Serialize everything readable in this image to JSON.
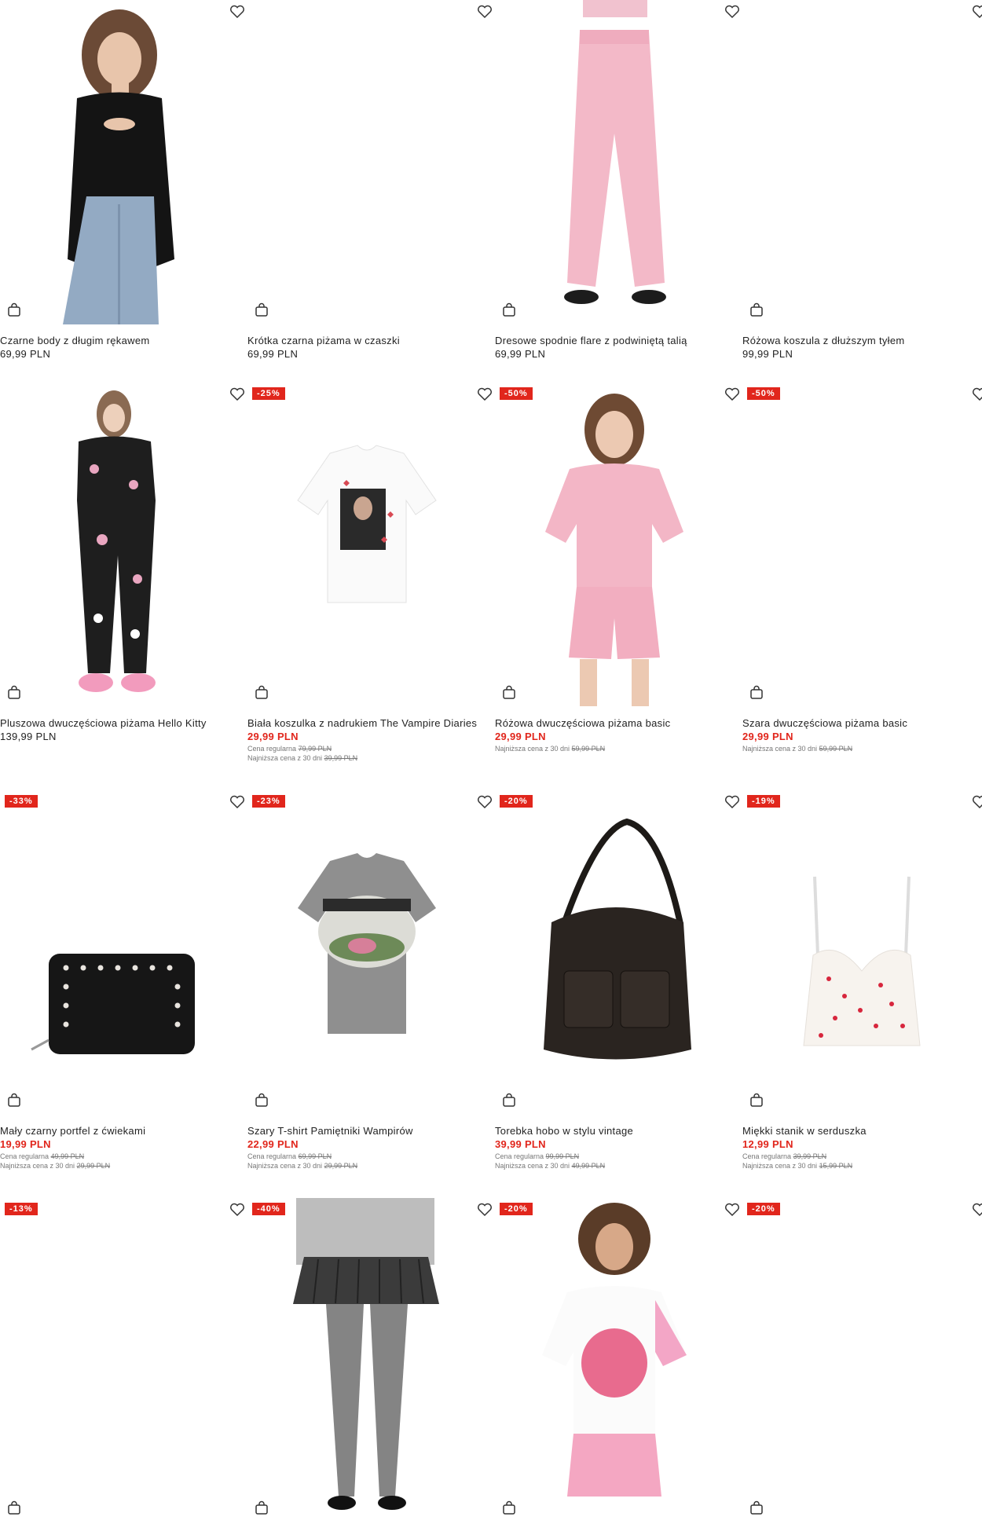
{
  "icons": {
    "wishlist": "heart-icon",
    "cart": "bag-icon"
  },
  "colors": {
    "sale": "#e1261c",
    "badge_bg": "#e1261c"
  },
  "products": [
    {
      "name": "Czarne body z długim rękawem",
      "price": "69,99 PLN",
      "badge": "",
      "regular_label": "",
      "regular": "",
      "lowest_label": "",
      "lowest": ""
    },
    {
      "name": "Krótka czarna piżama w czaszki",
      "price": "69,99 PLN",
      "badge": "",
      "regular_label": "",
      "regular": "",
      "lowest_label": "",
      "lowest": ""
    },
    {
      "name": "Dresowe spodnie flare z podwiniętą talią",
      "price": "69,99 PLN",
      "badge": "",
      "regular_label": "",
      "regular": "",
      "lowest_label": "",
      "lowest": ""
    },
    {
      "name": "Różowa koszula z dłuższym tyłem",
      "price": "99,99 PLN",
      "badge": "",
      "regular_label": "",
      "regular": "",
      "lowest_label": "",
      "lowest": ""
    },
    {
      "name": "Pluszowa dwuczęściowa piżama Hello Kitty",
      "price": "139,99 PLN",
      "badge": "",
      "regular_label": "",
      "regular": "",
      "lowest_label": "",
      "lowest": ""
    },
    {
      "name": "Biała koszulka z nadrukiem The Vampire Diaries",
      "price": "29,99 PLN",
      "badge": "-25%",
      "regular_label": "Cena regularna",
      "regular": "79,99 PLN",
      "lowest_label": "Najniższa cena z 30 dni",
      "lowest": "39,99 PLN"
    },
    {
      "name": "Różowa dwuczęściowa piżama basic",
      "price": "29,99 PLN",
      "badge": "-50%",
      "regular_label": "",
      "regular": "",
      "lowest_label": "Najniższa cena z 30 dni",
      "lowest": "59,99 PLN"
    },
    {
      "name": "Szara dwuczęściowa piżama basic",
      "price": "29,99 PLN",
      "badge": "-50%",
      "regular_label": "",
      "regular": "",
      "lowest_label": "Najniższa cena z 30 dni",
      "lowest": "59,99 PLN"
    },
    {
      "name": "Mały czarny portfel z ćwiekami",
      "price": "19,99 PLN",
      "badge": "-33%",
      "regular_label": "Cena regularna",
      "regular": "49,99 PLN",
      "lowest_label": "Najniższa cena z 30 dni",
      "lowest": "29,99 PLN"
    },
    {
      "name": "Szary T-shirt Pamiętniki Wampirów",
      "price": "22,99 PLN",
      "badge": "-23%",
      "regular_label": "Cena regularna",
      "regular": "69,99 PLN",
      "lowest_label": "Najniższa cena z 30 dni",
      "lowest": "29,99 PLN"
    },
    {
      "name": "Torebka hobo w stylu vintage",
      "price": "39,99 PLN",
      "badge": "-20%",
      "regular_label": "Cena regularna",
      "regular": "99,99 PLN",
      "lowest_label": "Najniższa cena z 30 dni",
      "lowest": "49,99 PLN"
    },
    {
      "name": "Miękki stanik w serduszka",
      "price": "12,99 PLN",
      "badge": "-19%",
      "regular_label": "Cena regularna",
      "regular": "39,99 PLN",
      "lowest_label": "Najniższa cena z 30 dni",
      "lowest": "15,99 PLN"
    },
    {
      "name": "",
      "price": "",
      "badge": "-13%",
      "regular_label": "",
      "regular": "",
      "lowest_label": "",
      "lowest": ""
    },
    {
      "name": "",
      "price": "",
      "badge": "-40%",
      "regular_label": "",
      "regular": "",
      "lowest_label": "",
      "lowest": ""
    },
    {
      "name": "",
      "price": "",
      "badge": "-20%",
      "regular_label": "",
      "regular": "",
      "lowest_label": "",
      "lowest": ""
    },
    {
      "name": "",
      "price": "",
      "badge": "-20%",
      "regular_label": "",
      "regular": "",
      "lowest_label": "",
      "lowest": ""
    }
  ]
}
